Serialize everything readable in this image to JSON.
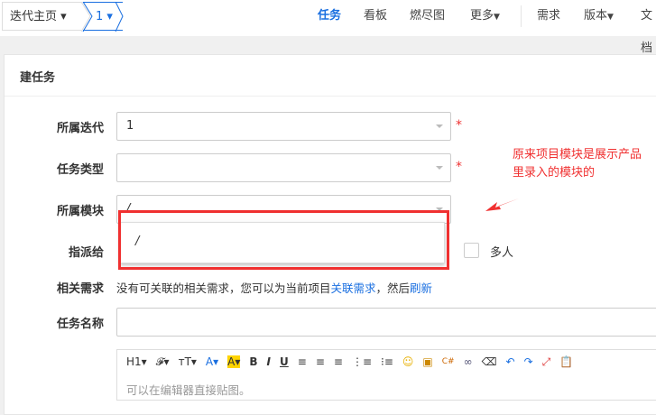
{
  "breadcrumb": {
    "home": "迭代主页",
    "current": "1"
  },
  "nav": {
    "items": [
      "任务",
      "看板",
      "燃尽图",
      "更多",
      "需求",
      "版本",
      "文档"
    ],
    "active": "任务"
  },
  "form": {
    "title": "建任务",
    "iteration_label": "所属迭代",
    "iteration_value": "1",
    "type_label": "任务类型",
    "type_value": "",
    "module_label": "所属模块",
    "module_value": "/",
    "module_option": "/",
    "assign_label": "指派给",
    "multi_label": "多人",
    "story_label": "相关需求",
    "story_text": "没有可关联的相关需求，您可以为当前项目",
    "story_link": "关联需求",
    "story_mid": "，然后",
    "refresh_link": "刷新",
    "name_label": "任务名称",
    "name_value": "",
    "editor_placeholder": "可以在编辑器直接贴图。"
  },
  "toolbar": [
    "H1▾",
    "𝓕▾",
    "тT▾",
    "A▾",
    "A▾",
    "B",
    "I",
    "U",
    "≡",
    "≡",
    "≡",
    "⋮≡",
    "⁝≡",
    "☺",
    "▣",
    "C#",
    "∞",
    "⌫",
    "↶",
    "↷",
    "⤢",
    "📋"
  ],
  "annotation": "原来项目模块是展示产品里录入的模块的",
  "colors": {
    "accent": "#1a6fe0",
    "annotation": "#f03030"
  }
}
